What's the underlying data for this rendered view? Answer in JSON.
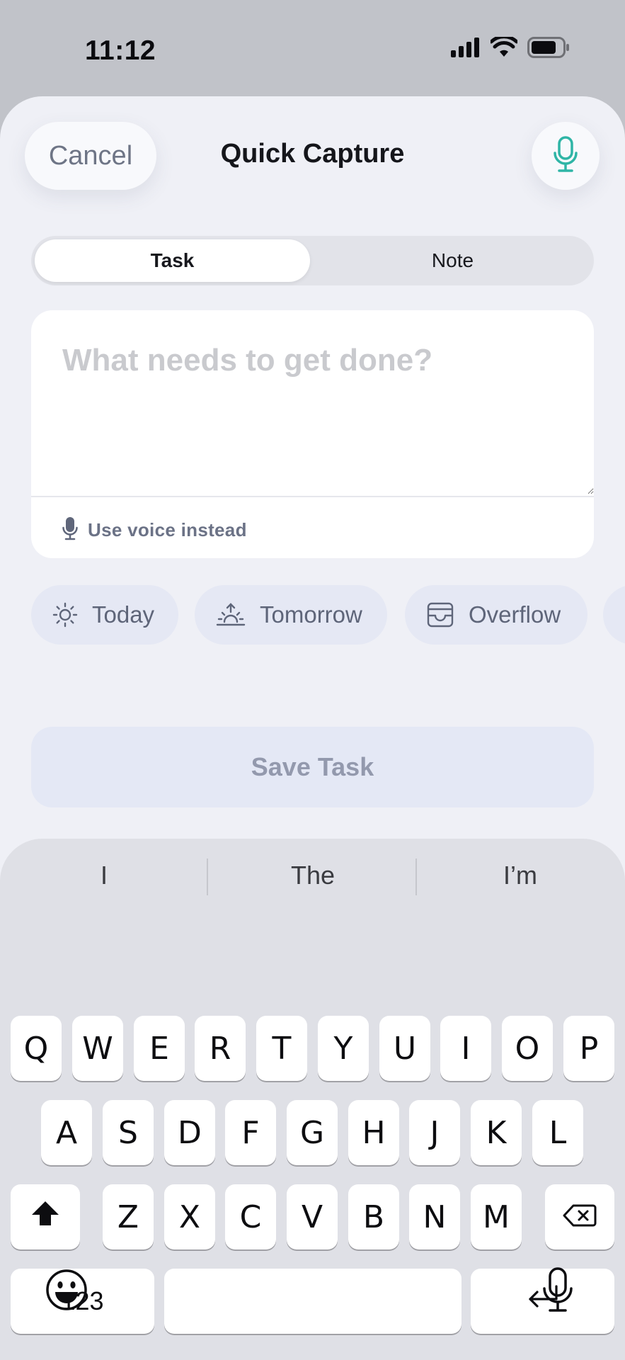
{
  "status_bar": {
    "time": "11:12"
  },
  "header": {
    "cancel_label": "Cancel",
    "title": "Quick Capture"
  },
  "segmented": {
    "tabs": [
      "Task",
      "Note"
    ],
    "selected": "Task"
  },
  "composer": {
    "placeholder": "What needs to get done?",
    "value": "",
    "voice_link_label": "Use voice instead"
  },
  "quick_chips": [
    {
      "label": "Today",
      "icon": "sun-icon"
    },
    {
      "label": "Tomorrow",
      "icon": "sunrise-icon"
    },
    {
      "label": "Overflow",
      "icon": "inbox-icon"
    }
  ],
  "save_button": {
    "label": "Save Task"
  },
  "keyboard": {
    "predictions": [
      "I",
      "The",
      "I’m"
    ],
    "row1": [
      "Q",
      "W",
      "E",
      "R",
      "T",
      "Y",
      "U",
      "I",
      "O",
      "P"
    ],
    "row2": [
      "A",
      "S",
      "D",
      "F",
      "G",
      "H",
      "J",
      "K",
      "L"
    ],
    "row3": [
      "Z",
      "X",
      "C",
      "V",
      "B",
      "N",
      "M"
    ],
    "numbers_label": "123",
    "icons": [
      "shift-icon",
      "delete-icon",
      "return-icon",
      "emoji-icon",
      "dictation-icon"
    ]
  },
  "colors": {
    "accent_teal": "#2fb5a6",
    "sheet_background": "#eff0f6",
    "chip_background": "#e5e8f4",
    "keyboard_background": "#dfe0e6"
  }
}
